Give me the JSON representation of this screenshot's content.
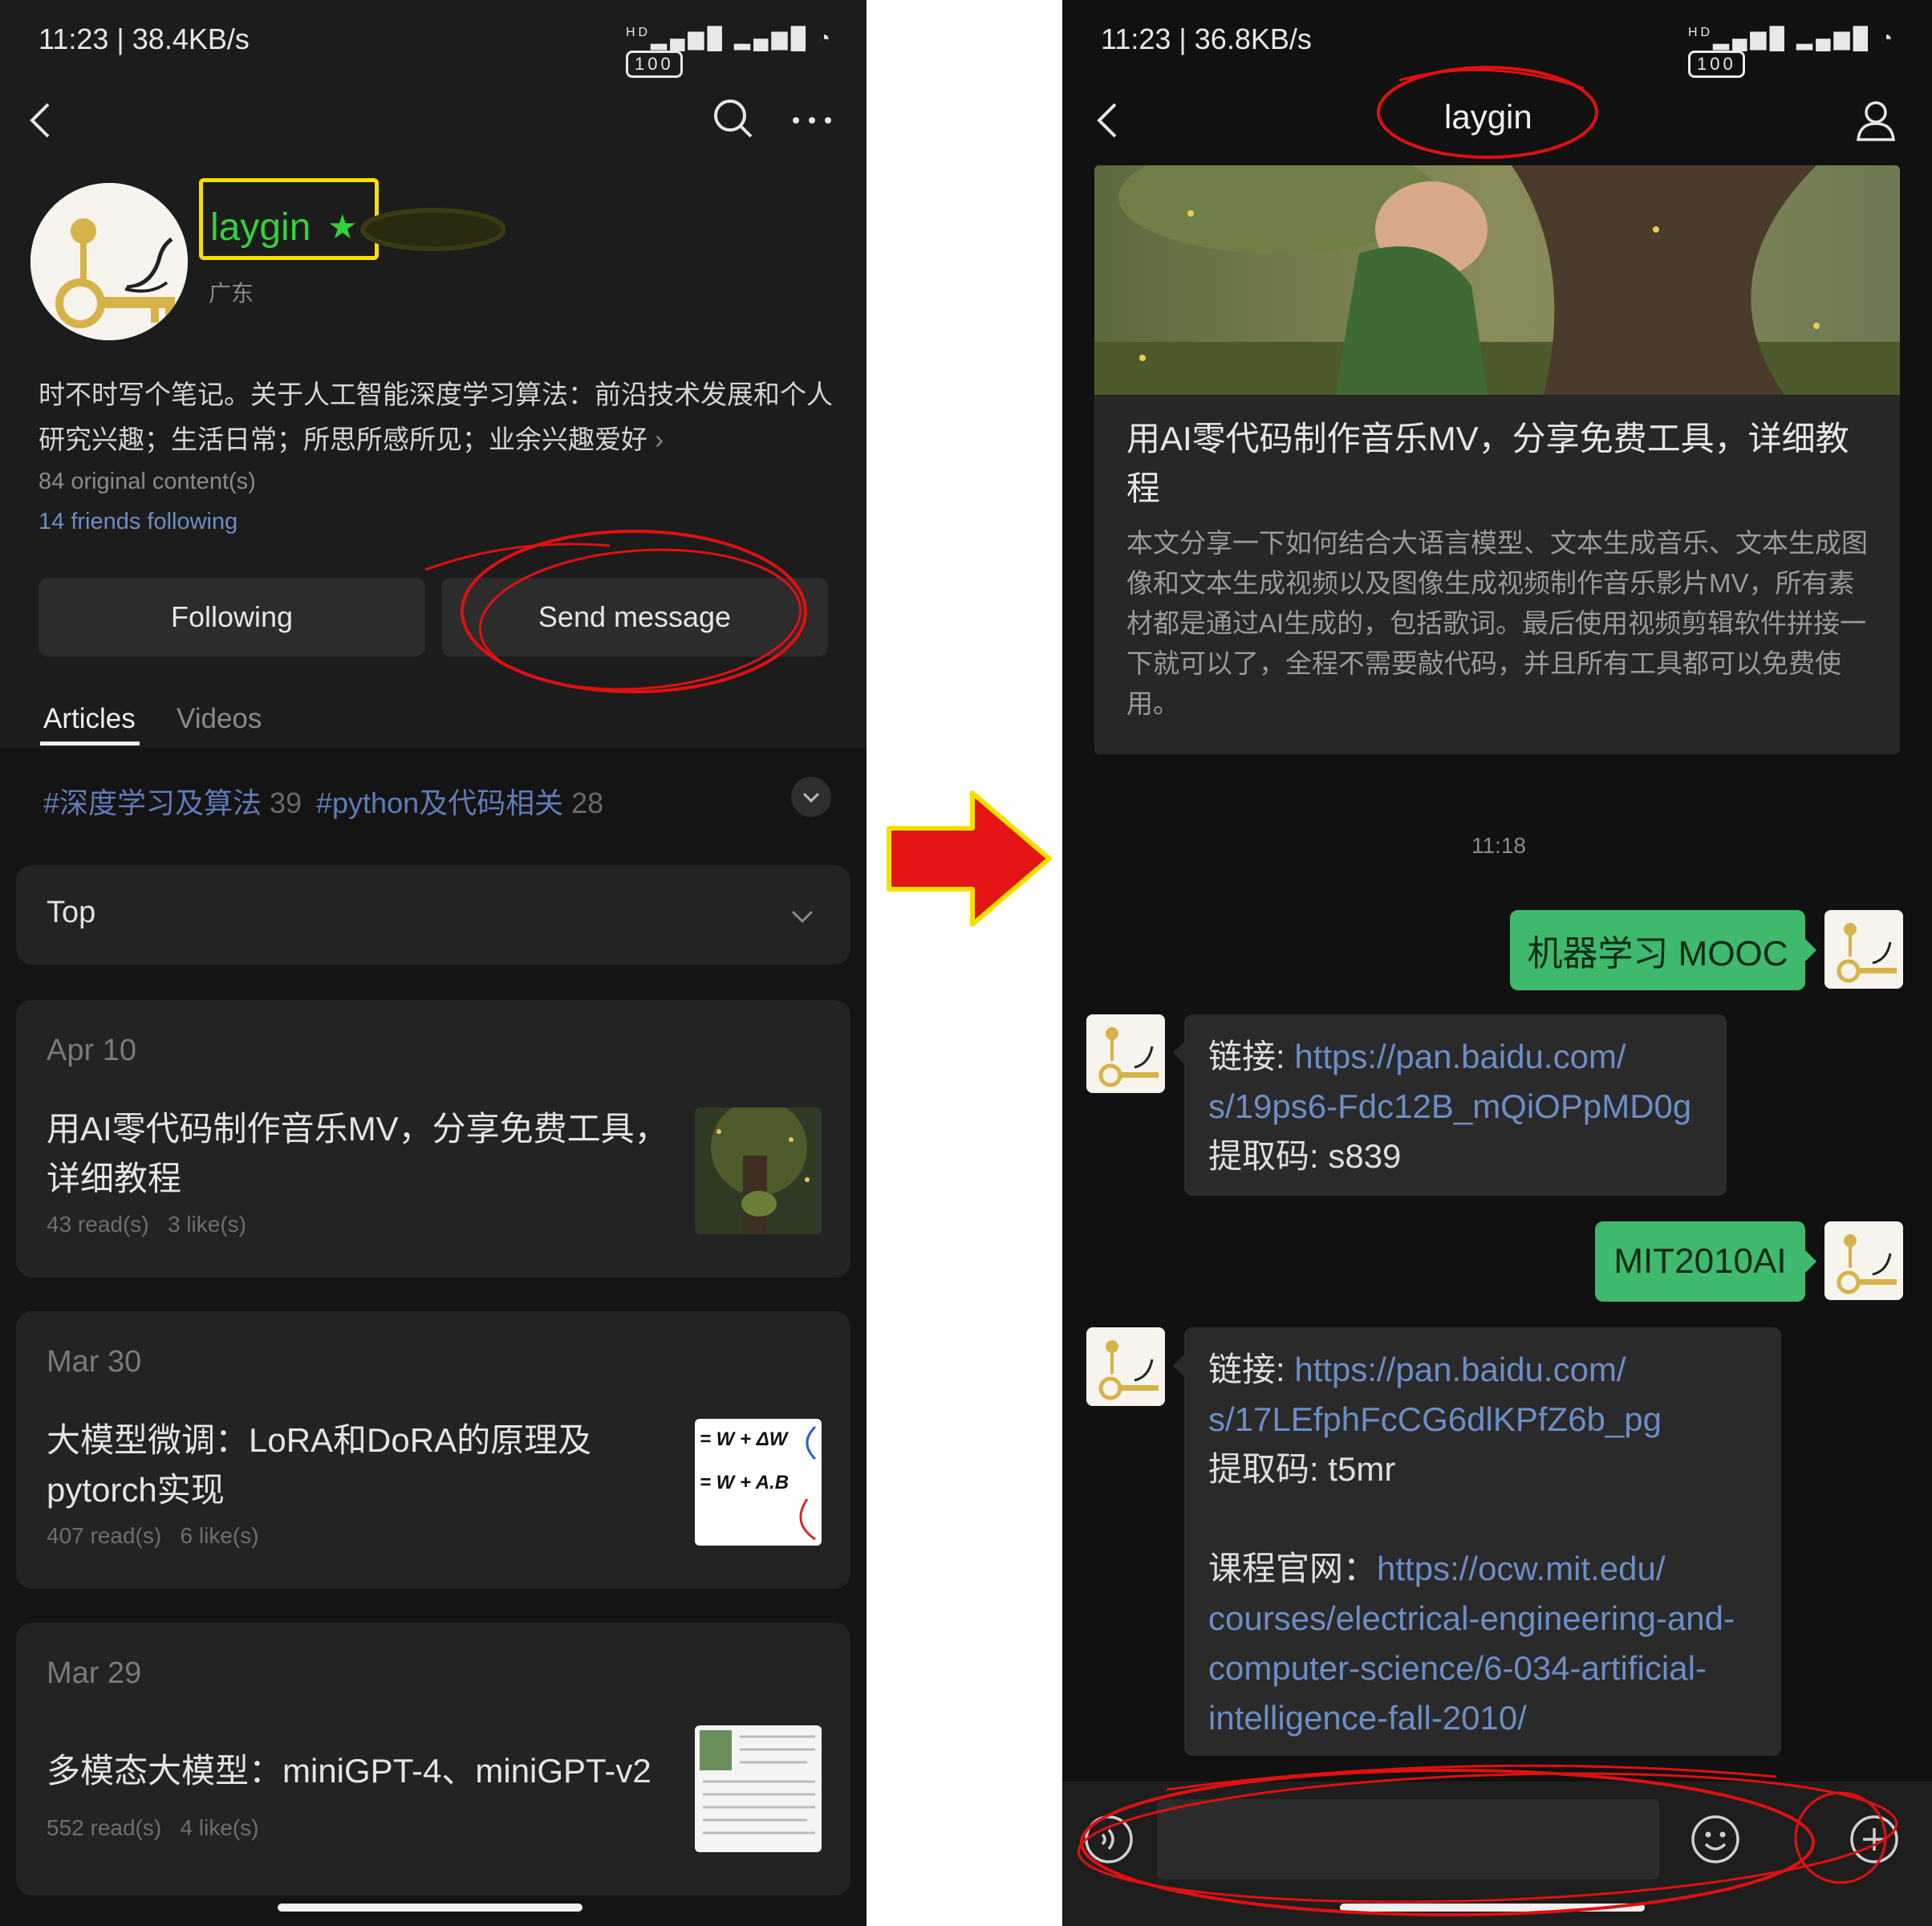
{
  "left": {
    "status": {
      "time": "11:23 | 38.4KB/s",
      "signal": "HD",
      "battery": "100"
    },
    "profile": {
      "name": "laygin",
      "location": "广东",
      "bio": "时不时写个笔记。关于人工智能深度学习算法：前沿技术发展和个人研究兴趣；生活日常；所思所感所见；业余兴趣爱好",
      "original_count": "84 original content(s)",
      "friends": "14 friends following"
    },
    "buttons": {
      "following": "Following",
      "send_message": "Send message"
    },
    "tabs": {
      "articles": "Articles",
      "videos": "Videos"
    },
    "tags": [
      {
        "label": "#深度学习及算法",
        "count": "39"
      },
      {
        "label": "#python及代码相关",
        "count": "28"
      }
    ],
    "sort": {
      "label": "Top"
    },
    "articles": [
      {
        "date": "Apr 10",
        "title": "用AI零代码制作音乐MV，分享免费工具，详细教程",
        "reads": "43 read(s)",
        "likes": "3 like(s)"
      },
      {
        "date": "Mar 30",
        "title": "大模型微调：LoRA和DoRA的原理及pytorch实现",
        "reads": "407 read(s)",
        "likes": "6 like(s)",
        "thumb_text_1": "= W + ΔW",
        "thumb_text_2": "= W + A.B"
      },
      {
        "date": "Mar 29",
        "title": "多模态大模型：miniGPT-4、miniGPT-v2",
        "reads": "552 read(s)",
        "likes": "4 like(s)"
      }
    ]
  },
  "right": {
    "status": {
      "time": "11:23 | 36.8KB/s",
      "signal": "HD",
      "battery": "100"
    },
    "header": {
      "title": "laygin"
    },
    "article_card": {
      "title": "用AI零代码制作音乐MV，分享免费工具，详细教程",
      "summary": "本文分享一下如何结合大语言模型、文本生成音乐、文本生成图像和文本生成视频以及图像生成视频制作音乐影片MV，所有素材都是通过AI生成的，包括歌词。最后使用视频剪辑软件拼接一下就可以了，全程不需要敲代码，并且所有工具都可以免费使用。"
    },
    "timestamp": "11:18",
    "messages": [
      {
        "side": "me",
        "text": "机器学习 MOOC"
      },
      {
        "side": "them",
        "link_label": "链接: ",
        "link_1": "https://pan.baidu.com/",
        "link_2": "s/19ps6-Fdc12B_mQiOPpMD0g",
        "code": "提取码: s839"
      },
      {
        "side": "me",
        "text": "MIT2010AI"
      },
      {
        "side": "them",
        "link_label": "链接: ",
        "link_1": "https://pan.baidu.com/",
        "link_2": "s/17LEfphFcCG6dlKPfZ6b_pg",
        "code": "提取码: t5mr",
        "site_label": "课程官网：",
        "site_1": "https://ocw.mit.edu/",
        "site_2": "courses/electrical-engineering-and-",
        "site_3": "computer-science/6-034-artificial-",
        "site_4": "intelligence-fall-2010/"
      }
    ]
  },
  "icons": {
    "back": "chevron-left-icon",
    "search": "search-icon",
    "more": "more-dots-icon",
    "star": "star-icon",
    "dropdown": "chevron-down-icon",
    "profile": "person-icon",
    "voice": "voice-icon",
    "emoji": "emoji-icon",
    "plus": "plus-icon",
    "arrow": "right-arrow-icon"
  },
  "colors": {
    "accent_green": "#3fb96e",
    "link_blue": "#6c8ec7",
    "highlight_yellow": "#f5e000",
    "name_green": "#35d13a",
    "annotation_red": "#e01010"
  }
}
